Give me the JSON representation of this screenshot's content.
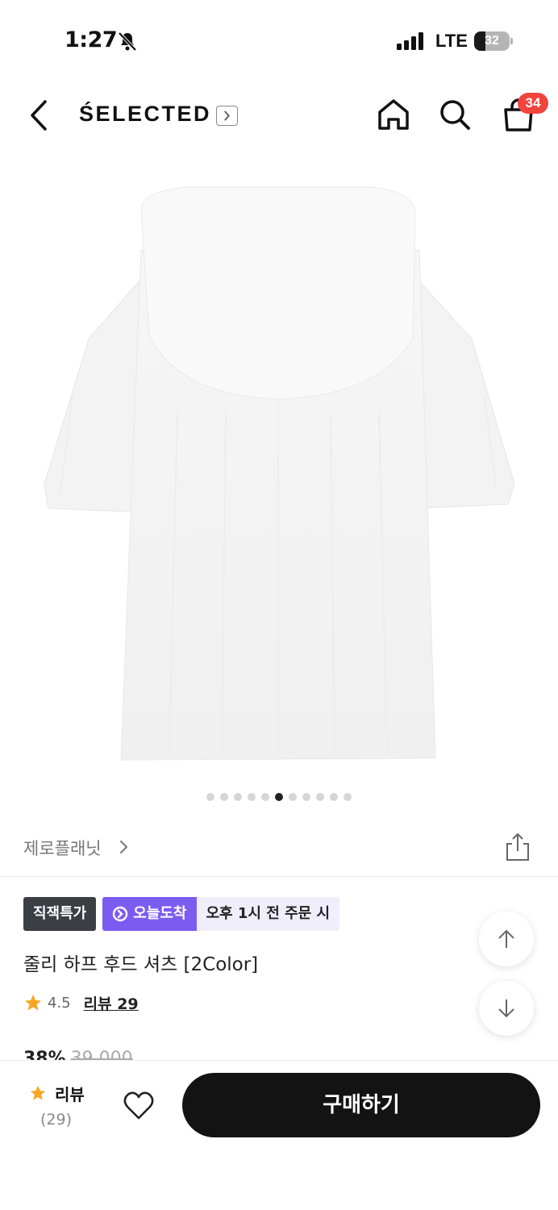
{
  "status_bar": {
    "time": "1:27",
    "network": "LTE",
    "battery_level": "32",
    "battery_fraction": 0.32
  },
  "nav": {
    "brand": "ŚELECTED",
    "cart_count": "34"
  },
  "carousel": {
    "total": 11,
    "active_index": 5
  },
  "brand_row": {
    "brand_name": "제로플래닛"
  },
  "badges": {
    "special": "직잭특가",
    "today_delivery": "오늘도착",
    "delivery_condition": "오후 1시 전 주문 시"
  },
  "product": {
    "title": "줄리 하프 후드 셔츠 [2Color]",
    "rating": "4.5",
    "review_link": "리뷰 29",
    "discount_peek": "38%",
    "original_price_peek": "39,000"
  },
  "bottom_bar": {
    "review_label": "리뷰",
    "review_count": "(29)",
    "buy_label": "구매하기"
  },
  "colors": {
    "accent_purple": "#7b5cf0",
    "badge_dark": "#3b3f44",
    "cart_badge": "#f0443c",
    "star": "#f5a623",
    "buy_button": "#131313"
  }
}
